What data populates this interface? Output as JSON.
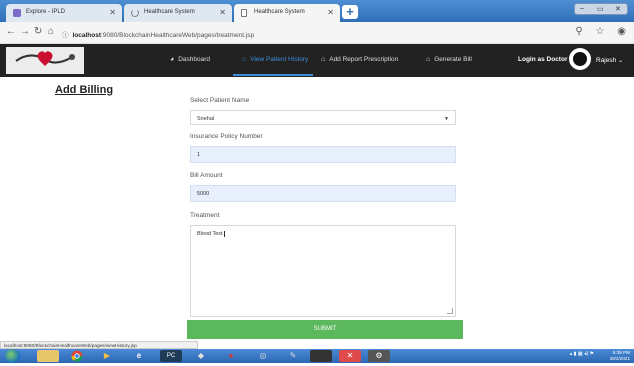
{
  "browser": {
    "tabs": [
      {
        "title": "Explore - IPLD",
        "icon": "tab-favicon"
      },
      {
        "title": "Healthcare System",
        "icon": "loading-spinner-icon"
      },
      {
        "title": "Healthcare System",
        "icon": "page-icon"
      }
    ],
    "address": {
      "host": "localhost",
      "port_path": ":9080/BlockchainHealthcareWeb/pages/treatment.jsp"
    },
    "status_url": "localhost:9080/BlockchainHealthcareWeb/pages/viewHistory.jsp"
  },
  "nav": {
    "items": [
      {
        "label": "Dashboard",
        "icon": "dashboard-icon",
        "active": false
      },
      {
        "label": "View Patient History",
        "icon": "home-icon",
        "active": true
      },
      {
        "label": "Add Report Prescription",
        "icon": "home-icon",
        "active": false
      },
      {
        "label": "Generate Bill",
        "icon": "home-icon",
        "active": false
      }
    ],
    "login_as": "Login as Doctor",
    "user": "Rajesh",
    "accent": "#3b8fd9"
  },
  "form": {
    "title": "Add Billing",
    "patient_label": "Select Patient Name",
    "patient_value": "Snehal",
    "policy_label": "Insurance Policy Number",
    "policy_value": "1",
    "amount_label": "Bill Amount",
    "amount_value": "5000",
    "treatment_label": "Treatment",
    "treatment_value": "Blood Test",
    "submit_label": "SUBMIT",
    "submit_color": "#5cb85c"
  },
  "taskbar": {
    "time": "8:39 PM",
    "date": "25/2/2021"
  }
}
